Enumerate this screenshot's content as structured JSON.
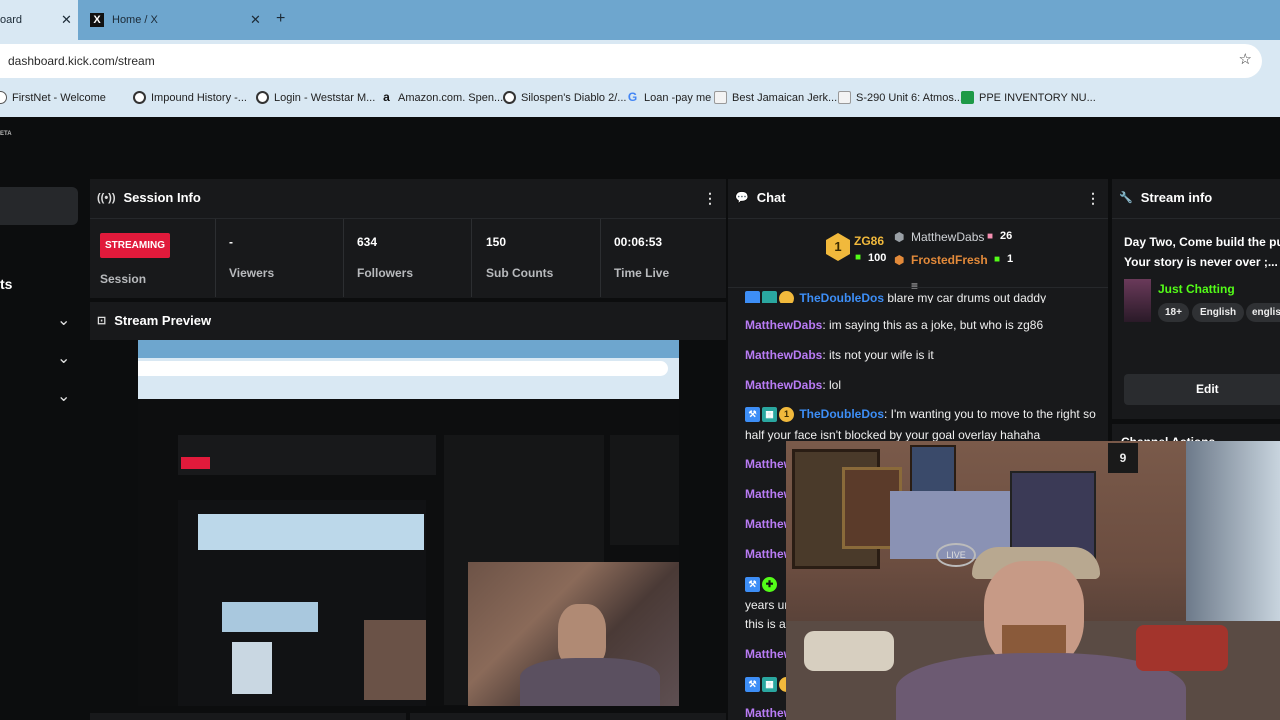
{
  "browser": {
    "tabs": [
      {
        "title": "oard",
        "close": "✕"
      },
      {
        "title": "Home / X",
        "close": "✕",
        "logo": "X"
      }
    ],
    "new_tab": "+",
    "url": "dashboard.kick.com/stream",
    "bookmarks": [
      {
        "label": "FirstNet - Welcome",
        "icon": "globe-icon"
      },
      {
        "label": "Impound History -...",
        "icon": "globe-icon"
      },
      {
        "label": "Login - Weststar M...",
        "icon": "globe-icon"
      },
      {
        "label": "Amazon.com. Spen...",
        "icon": "amazon-icon",
        "glyph": "a"
      },
      {
        "label": "Silospen's Diablo 2/...",
        "icon": "globe-icon"
      },
      {
        "label": "Loan -pay me",
        "icon": "google-icon",
        "glyph": "G"
      },
      {
        "label": "Best Jamaican Jerk...",
        "icon": "page-icon"
      },
      {
        "label": "S-290 Unit 6: Atmos...",
        "icon": "page-icon"
      },
      {
        "label": "PPE INVENTORY NU...",
        "icon": "sheets-icon"
      }
    ]
  },
  "sidebar": {
    "beta_tag": "ETA",
    "section_title": "ts"
  },
  "session": {
    "title": "Session Info",
    "badge": "STREAMING",
    "session_label": "Session",
    "stats": [
      {
        "value": "-",
        "label": "Viewers"
      },
      {
        "value": "634",
        "label": "Followers"
      },
      {
        "value": "150",
        "label": "Sub Counts"
      },
      {
        "value": "00:06:53",
        "label": "Time Live"
      }
    ]
  },
  "preview": {
    "title": "Stream Preview"
  },
  "chat": {
    "title": "Chat",
    "leader": {
      "rank": "1",
      "name": "ZG86",
      "count": "100"
    },
    "gifters": [
      {
        "name": "MatthewDabs",
        "count": "26"
      },
      {
        "name": "FrostedFresh",
        "count": "1"
      }
    ],
    "messages": [
      {
        "user": "TheDoubleDos",
        "text": "blare my car drums out daddy"
      },
      {
        "user": "MatthewDabs",
        "text": ": im saying this as a joke, but who is zg86"
      },
      {
        "user": "MatthewDabs",
        "text": ": its not your wife is it"
      },
      {
        "user": "MatthewDabs",
        "text": ": lol"
      },
      {
        "user": "TheDoubleDos",
        "text": ": I'm wanting you to move to the right so",
        "text2": "half your face isn't blocked by your goal overlay hahaha"
      },
      {
        "user": "Matthew"
      },
      {
        "user": "Matthew"
      },
      {
        "user": "Matthew"
      },
      {
        "user": "Matthew"
      },
      {
        "text": "years ur"
      },
      {
        "text": "this is a"
      },
      {
        "user": "Matthew"
      },
      {
        "user": "Matthew"
      }
    ]
  },
  "stream_info": {
    "title": "Stream info",
    "stream_title_l1": "Day Two, Come build the pur",
    "stream_title_l2": "Your story is never over ;...",
    "category": "Just Chatting",
    "tags": [
      "18+",
      "English",
      "englis"
    ],
    "edit_label": "Edit",
    "next_section": "Channel Actions"
  },
  "colors": {
    "kick_green": "#53fc18",
    "streaming_red": "#e11a3b",
    "chat_purple": "#b97cf5",
    "chat_blue": "#3d8ef6"
  }
}
